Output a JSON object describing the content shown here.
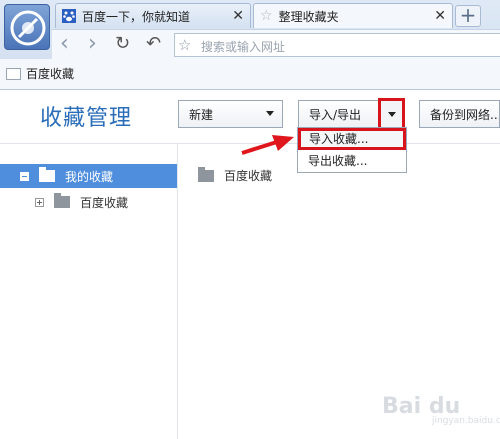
{
  "tabs": [
    {
      "title": "百度一下，你就知道",
      "icon": "paw-icon",
      "active": false
    },
    {
      "title": "整理收藏夹",
      "icon": "star-icon",
      "active": true
    }
  ],
  "new_tab_label": "+",
  "address_bar": {
    "placeholder": "搜索或输入网址"
  },
  "bookmarks_bar": {
    "items": [
      {
        "label": "百度收藏"
      }
    ]
  },
  "manager": {
    "title": "收藏管理",
    "new_label": "新建",
    "import_export_label": "导入/导出",
    "backup_label": "备份到网络...",
    "dropdown": [
      {
        "label": "导入收藏...",
        "highlighted": true
      },
      {
        "label": "导出收藏..."
      }
    ]
  },
  "tree": [
    {
      "label": "我的收藏",
      "selected": true
    },
    {
      "label": "百度收藏",
      "selected": false
    }
  ],
  "list": [
    {
      "label": "百度收藏"
    }
  ],
  "watermark": {
    "text": "Bai du",
    "sub": "jingyan.baidu.com"
  },
  "colors": {
    "accent": "#2a6db8",
    "highlight": "#d7141b",
    "selection": "#4f8edc"
  }
}
